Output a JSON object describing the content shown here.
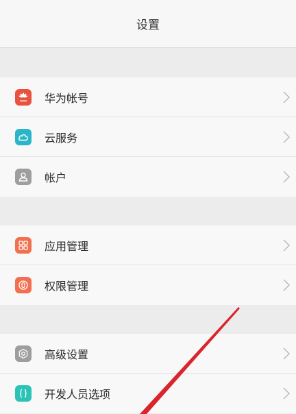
{
  "header": {
    "title": "设置"
  },
  "groups": [
    {
      "items": [
        {
          "label": "华为帐号",
          "icon": "huawei-logo-icon",
          "icon_color": "#e8533f"
        },
        {
          "label": "云服务",
          "icon": "cloud-icon",
          "icon_color": "#2bb5c8"
        },
        {
          "label": "帐户",
          "icon": "person-icon",
          "icon_color": "#9e9e9e"
        }
      ]
    },
    {
      "items": [
        {
          "label": "应用管理",
          "icon": "apps-grid-icon",
          "icon_color": "#f2704f"
        },
        {
          "label": "权限管理",
          "icon": "permission-icon",
          "icon_color": "#f2704f"
        }
      ]
    },
    {
      "items": [
        {
          "label": "高级设置",
          "icon": "gear-icon",
          "icon_color": "#9e9e9e"
        },
        {
          "label": "开发人员选项",
          "icon": "braces-icon",
          "icon_color": "#2bc3b6"
        }
      ]
    }
  ],
  "colors": {
    "background": "#ececec",
    "row_background": "#f8f8f8",
    "annotation_line": "#d9252b"
  }
}
